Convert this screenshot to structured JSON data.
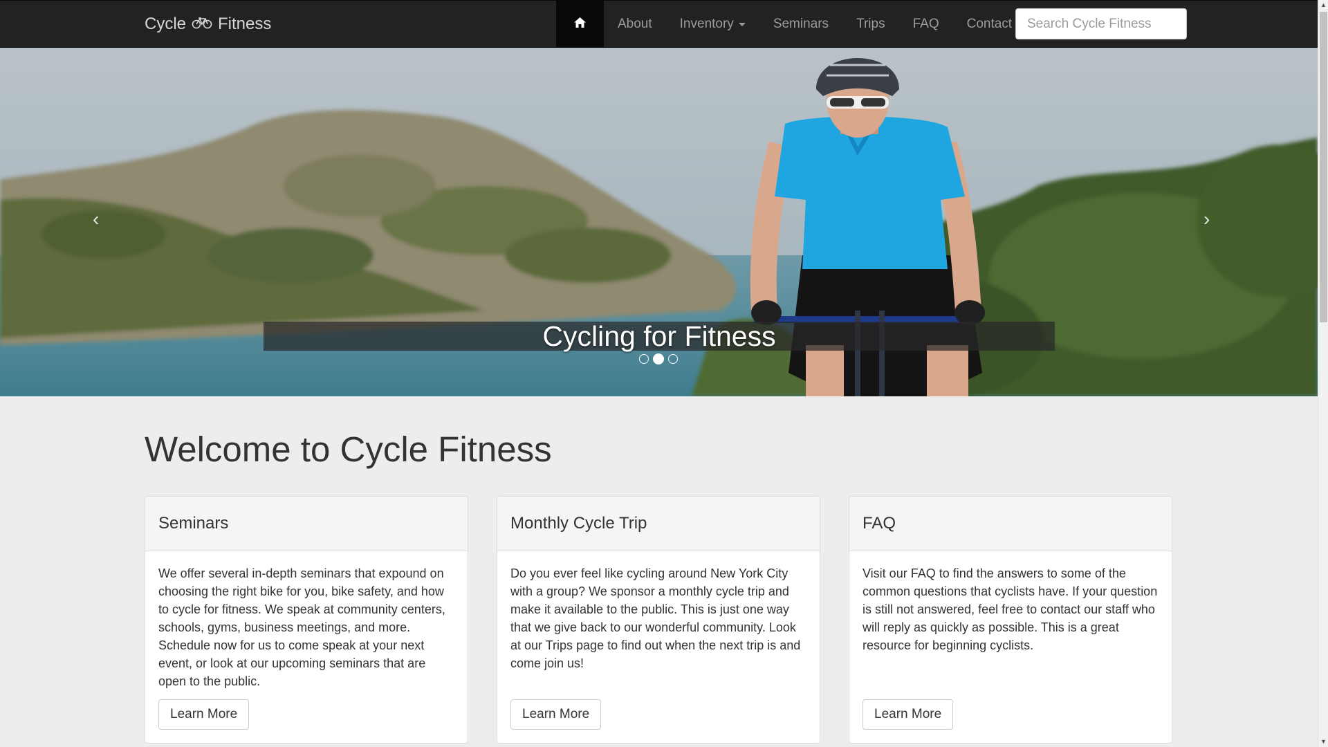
{
  "brand": {
    "prefix": "Cycle",
    "suffix": "Fitness"
  },
  "nav": {
    "home_icon": "home-icon",
    "items": [
      "About",
      "Inventory",
      "Seminars",
      "Trips",
      "FAQ",
      "Contact"
    ]
  },
  "search": {
    "placeholder": "Search Cycle Fitness",
    "value": ""
  },
  "carousel": {
    "caption": "Cycling for Fitness",
    "prev_icon": "chevron-left-icon",
    "next_icon": "chevron-right-icon",
    "slide_count": 3,
    "active_slide": 2
  },
  "main": {
    "title": "Welcome to Cycle Fitness",
    "panels": [
      {
        "heading": "Seminars",
        "body": "We offer several in-depth seminars that expound on choosing the right bike for you, bike safety, and how to cycle for fitness. We speak at community centers, schools, gyms, business meetings, and more. Schedule now for us to come speak at your next event, or look at our upcoming seminars that are open to the public.",
        "button": "Learn More"
      },
      {
        "heading": "Monthly Cycle Trip",
        "body": "Do you ever feel like cycling around New York City with a group? We sponsor a monthly cycle trip and make it available to the public. This is just one way that we give back to our wonderful community. Look at our Trips page to find out when the next trip is and come join us!",
        "button": "Learn More"
      },
      {
        "heading": "FAQ",
        "body": "Visit our FAQ to find the answers to some of the common questions that cyclists have. If your question is still not answered, feel free to contact our staff who will reply as quickly as possible. This is a great resource for beginning cyclists.",
        "button": "Learn More"
      }
    ]
  },
  "colors": {
    "navbar": "#222222",
    "accent_shirt": "#1fa6e0",
    "page_bg": "#ededed"
  }
}
